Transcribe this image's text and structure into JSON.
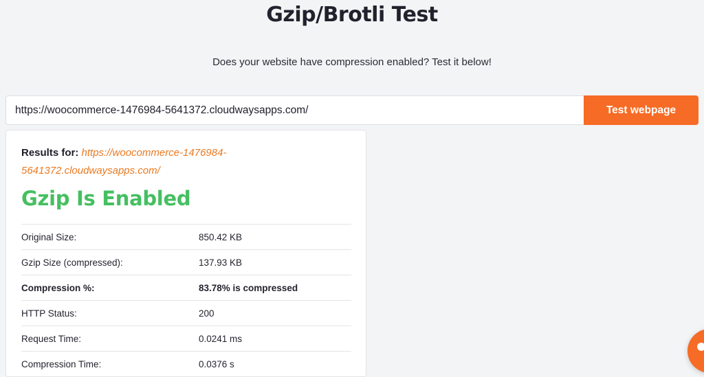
{
  "page": {
    "title": "Gzip/Brotli Test",
    "subtitle": "Does your website have compression enabled? Test it below!"
  },
  "form": {
    "url_value": "https://woocommerce-1476984-5641372.cloudwaysapps.com/",
    "button_label": "Test webpage"
  },
  "results": {
    "label": "Results for:",
    "url": "https://woocommerce-1476984-5641372.cloudwaysapps.com/",
    "status": "Gzip Is Enabled",
    "rows": [
      {
        "label": "Original Size:",
        "value": "850.42 KB"
      },
      {
        "label": "Gzip Size (compressed):",
        "value": "137.93 KB"
      },
      {
        "label": "Compression %:",
        "value": "83.78% is compressed"
      },
      {
        "label": "HTTP Status:",
        "value": "200"
      },
      {
        "label": "Request Time:",
        "value": "0.0241 ms"
      },
      {
        "label": "Compression Time:",
        "value": "0.0376 s"
      }
    ]
  },
  "chat_widget": {
    "icon": "chat-icon"
  },
  "colors": {
    "accent": "#f66b25",
    "link": "#ea7a22",
    "success": "#46bf61",
    "background": "#f3f4f6"
  }
}
